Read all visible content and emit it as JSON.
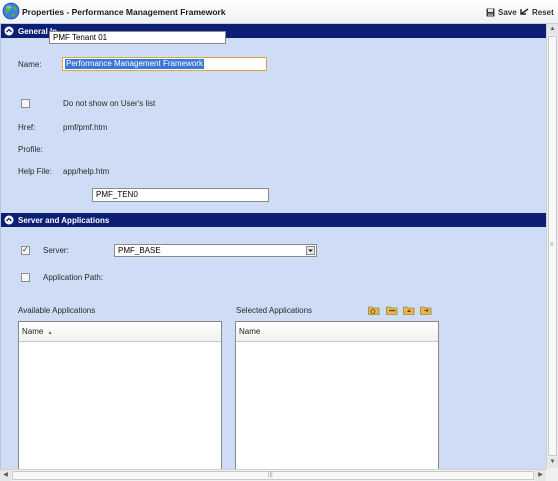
{
  "window": {
    "title": "Properties - Performance Management Framework",
    "save_label": "Save",
    "reset_label": "Reset"
  },
  "general": {
    "header": "General In",
    "tenant_value": "PMF Tenant 01",
    "name_label": "Name:",
    "name_value": "Performance Management Framework",
    "hide_label": "Do not show on User's list",
    "href_label": "Href:",
    "href_value": "pmf/pmf.htm",
    "profile_label": "Profile:",
    "helpfile_label": "Help File:",
    "helpfile_value": "app/help.htm",
    "tenant_code_value": "PMF_TEN0"
  },
  "server_apps": {
    "header": "Server and Applications",
    "server_label": "Server:",
    "server_value": "PMF_BASE",
    "server_checked": true,
    "app_path_label": "Application Path:",
    "available_label": "Available Applications",
    "selected_label": "Selected Applications",
    "available_col": "Name",
    "selected_col": "Name",
    "available_rows": [],
    "selected_rows": []
  },
  "icons": {
    "section_collapse": "chevron-up-circle-icon",
    "globe": "globe-icon",
    "save": "save-disk-icon",
    "reset": "reset-arrow-icon",
    "actions": [
      "folder-search-icon",
      "folder-icon",
      "folder-up-icon",
      "folder-move-icon"
    ]
  },
  "colors": {
    "header_bg": "#0c1f74",
    "panel_bg": "#cfdcf6",
    "selection": "#3a78d6",
    "focus_border": "#e0a53a"
  }
}
